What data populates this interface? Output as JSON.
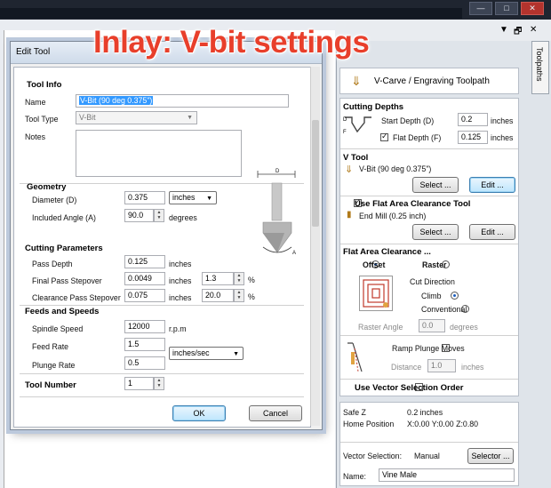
{
  "overlay": {
    "title": "Inlay: V-bit settings"
  },
  "window_controls": [
    "—",
    "□",
    "✕"
  ],
  "dialog": {
    "title": "Edit Tool",
    "tool_info": {
      "heading": "Tool Info",
      "name_label": "Name",
      "name_value": "V-Bit (90 deg 0.375\")",
      "tool_type_label": "Tool Type",
      "tool_type_value": "V-Bit",
      "notes_label": "Notes"
    },
    "geometry": {
      "heading": "Geometry",
      "diameter_label": "Diameter (D)",
      "diameter_value": "0.375",
      "diameter_units": "inches",
      "angle_label": "Included Angle (A)",
      "angle_value": "90.0",
      "angle_units": "degrees",
      "diagram_d": "D",
      "diagram_a": "A"
    },
    "cutting": {
      "heading": "Cutting Parameters",
      "pass_depth_label": "Pass Depth",
      "pass_depth_value": "0.125",
      "pass_depth_units": "inches",
      "final_label": "Final Pass Stepover",
      "final_value": "0.0049",
      "final_units": "inches",
      "final_pct": "1.3",
      "clear_label": "Clearance Pass Stepover",
      "clear_value": "0.075",
      "clear_units": "inches",
      "clear_pct": "20.0",
      "pct_symbol": "%"
    },
    "feeds": {
      "heading": "Feeds and Speeds",
      "spindle_label": "Spindle Speed",
      "spindle_value": "12000",
      "spindle_units": "r.p.m",
      "feed_label": "Feed Rate",
      "feed_value": "1.5",
      "plunge_label": "Plunge Rate",
      "plunge_value": "0.5",
      "rate_units": "inches/sec"
    },
    "tool_number": {
      "label": "Tool Number",
      "value": "1"
    },
    "ok_label": "OK",
    "cancel_label": "Cancel"
  },
  "panel": {
    "header_icons": [
      "▼",
      "🗗",
      "✕"
    ],
    "tab_label": "Toolpaths",
    "title": "V-Carve / Engraving Toolpath",
    "cutting_depths": {
      "heading": "Cutting Depths",
      "start_label": "Start Depth (D)",
      "start_value": "0.2",
      "start_units": "inches",
      "flat_label": "Flat Depth (F)",
      "flat_value": "0.125",
      "flat_units": "inches"
    },
    "vtool": {
      "heading": "V Tool",
      "name": "V-Bit (90 deg 0.375\")",
      "select_label": "Select ...",
      "edit_label": "Edit ..."
    },
    "flat_area_tool": {
      "heading": "Use Flat Area Clearance Tool",
      "name": "End Mill (0.25 inch)",
      "select_label": "Select ...",
      "edit_label": "Edit ..."
    },
    "flat_area_clearance": {
      "heading": "Flat Area Clearance ...",
      "offset_label": "Offset",
      "raster_label": "Raster",
      "cut_direction_label": "Cut Direction",
      "climb_label": "Climb",
      "conventional_label": "Conventional",
      "raster_angle_label": "Raster Angle",
      "raster_angle_value": "0.0",
      "raster_angle_units": "degrees"
    },
    "ramp": {
      "label": "Ramp Plunge Moves",
      "distance_label": "Distance",
      "distance_value": "1.0",
      "distance_units": "inches"
    },
    "vector_order_label": "Use Vector Selection Order",
    "safe_z_label": "Safe Z",
    "safe_z_value": "0.2 inches",
    "home_label": "Home Position",
    "home_value": "X:0.00 Y:0.00 Z:0.80",
    "vector_selection_label": "Vector Selection:",
    "vector_selection_value": "Manual",
    "selector_label": "Selector ...",
    "name_label": "Name:",
    "name_value": "Vine Male"
  }
}
